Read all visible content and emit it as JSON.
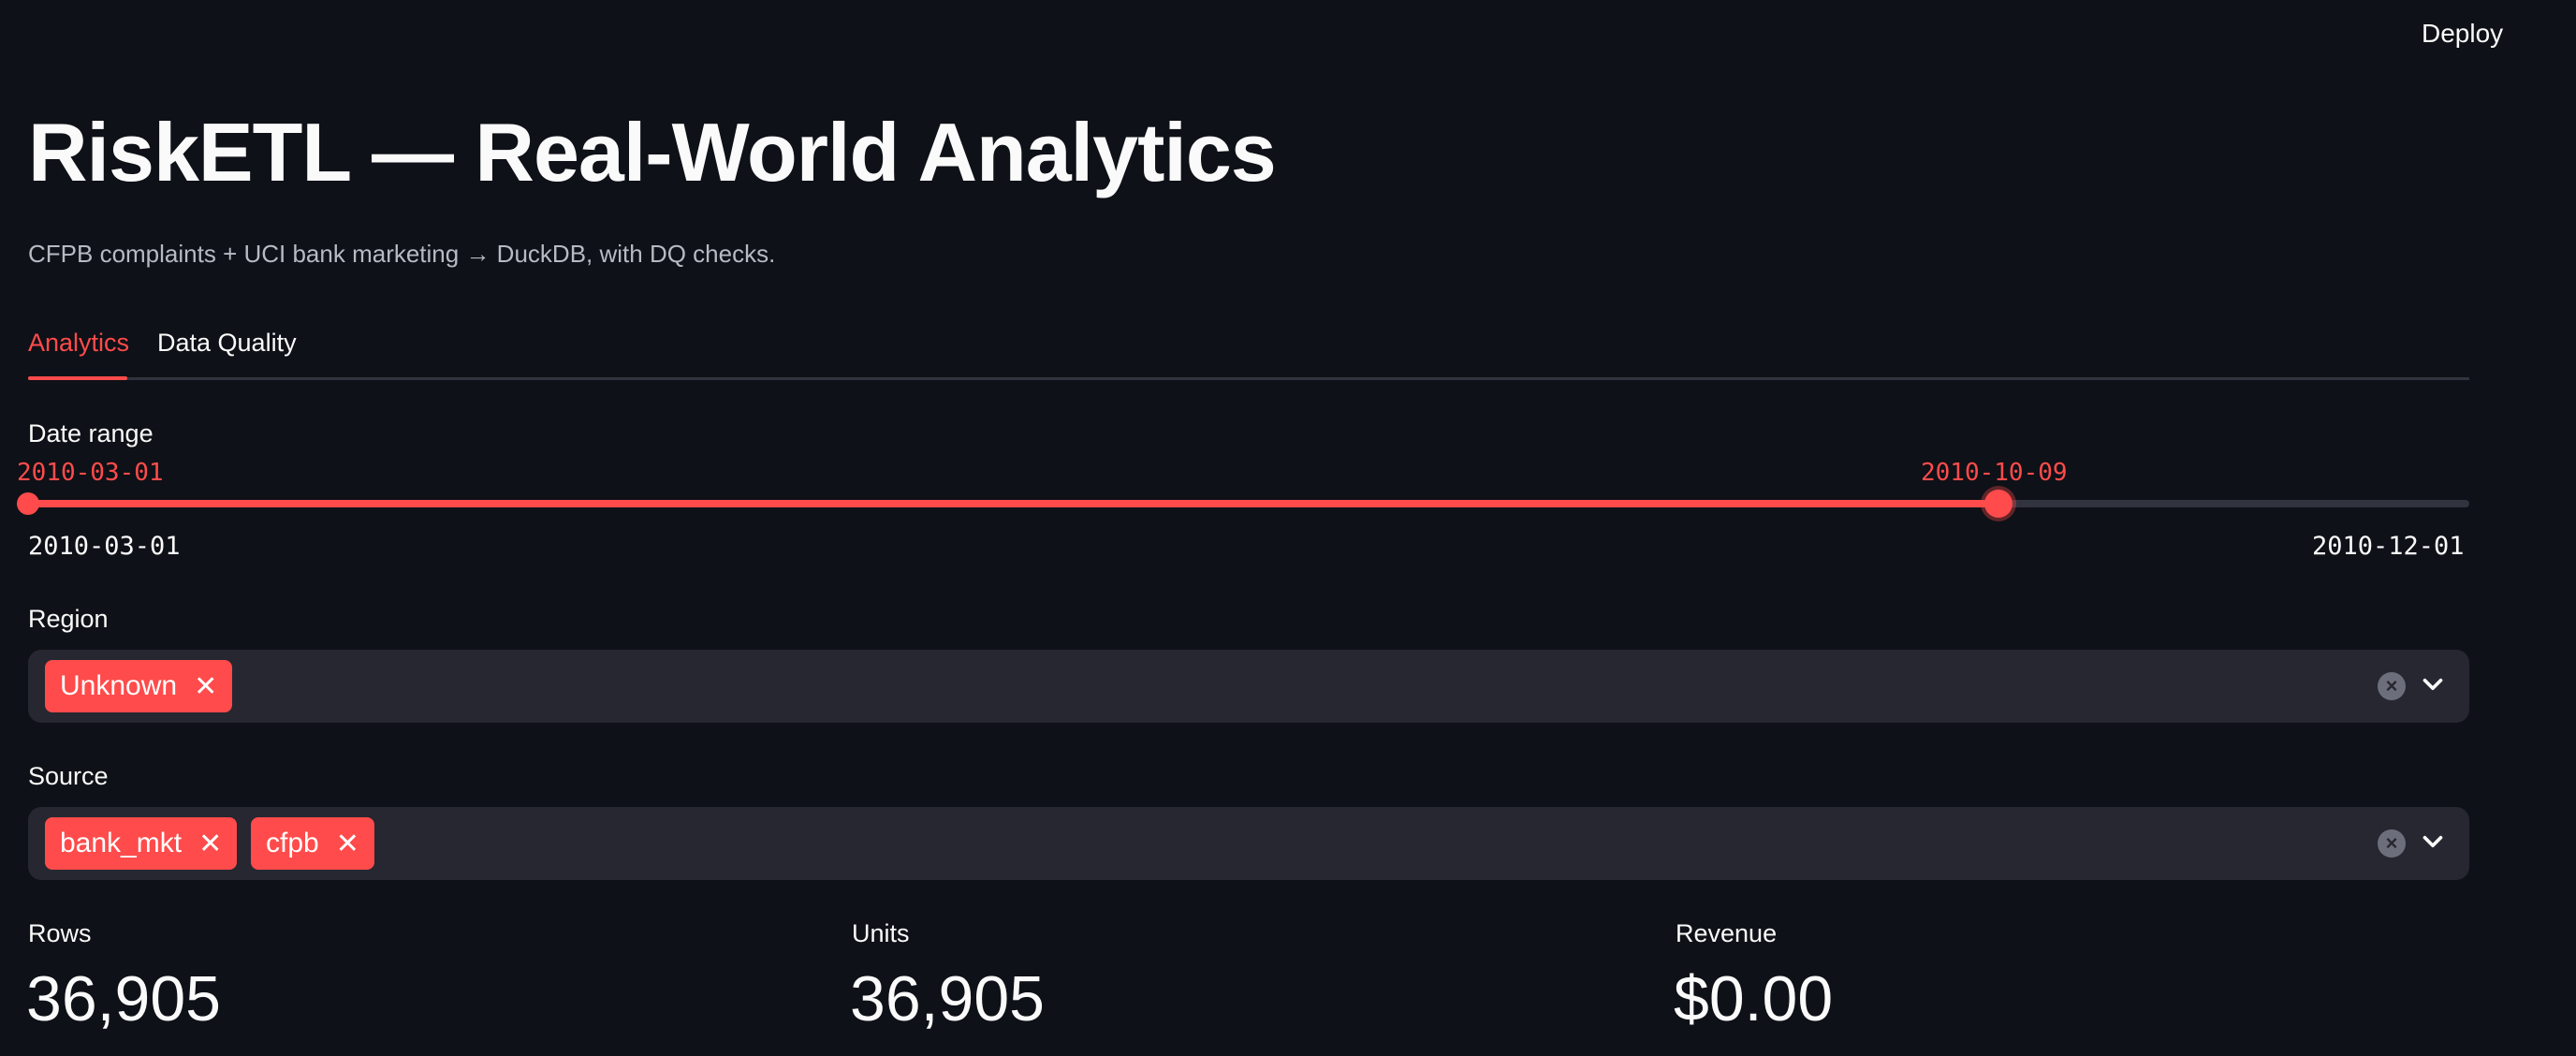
{
  "header": {
    "deploy_label": "Deploy"
  },
  "page": {
    "title": "RiskETL — Real-World Analytics",
    "subtitle": "CFPB complaints + UCI bank marketing → DuckDB, with DQ checks."
  },
  "tabs": [
    {
      "label": "Analytics",
      "active": true
    },
    {
      "label": "Data Quality",
      "active": false
    }
  ],
  "date_range": {
    "label": "Date range",
    "start_value": "2010-03-01",
    "end_value": "2010-10-09",
    "min": "2010-03-01",
    "max": "2010-12-01"
  },
  "region": {
    "label": "Region",
    "selected": [
      "Unknown"
    ]
  },
  "source": {
    "label": "Source",
    "selected": [
      "bank_mkt",
      "cfpb"
    ]
  },
  "metrics": [
    {
      "label": "Rows",
      "value": "36,905"
    },
    {
      "label": "Units",
      "value": "36,905"
    },
    {
      "label": "Revenue",
      "value": "$0.00"
    }
  ],
  "colors": {
    "background": "#0e1117",
    "accent": "#ff4b4b",
    "widget_bg": "#262730",
    "muted_text": "#b7bac3"
  },
  "icons": {
    "menu": "vertical-ellipsis-icon",
    "clear": "clear-circle-icon",
    "dropdown": "chevron-down-icon",
    "remove_chip": "close-icon"
  }
}
